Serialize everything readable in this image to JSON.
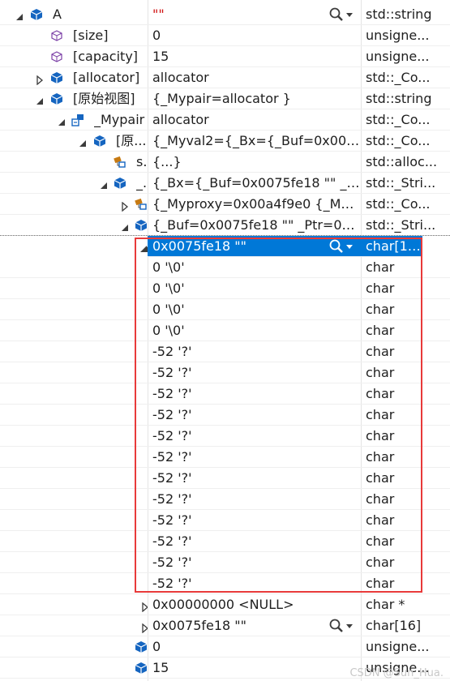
{
  "rows": [
    {
      "name": "A",
      "value": "\"\"",
      "type": "std::string",
      "value_color": "#d01010"
    },
    {
      "name": "[size]",
      "value": "0",
      "type": "unsigne..."
    },
    {
      "name": "[capacity]",
      "value": "15",
      "type": "unsigne..."
    },
    {
      "name": "[allocator]",
      "value": "allocator",
      "type": "std::_Co..."
    },
    {
      "name": "[原始视图]",
      "value": "{_Mypair=allocator }",
      "type": "std::string"
    },
    {
      "name": "_Mypair",
      "value": "allocator",
      "type": "std::_Co..."
    },
    {
      "name": "[原...",
      "value": "{_Myval2={_Bx={_Buf=0x0075fe...",
      "type": "std::_Co..."
    },
    {
      "name": "s...",
      "value": "{...}",
      "type": "std::alloc..."
    },
    {
      "name": "_...",
      "value": "{_Bx={_Buf=0x0075fe18 \"\" _Ptr=...",
      "type": "std::_Stri..."
    },
    {
      "name": "",
      "value": "{_Myproxy=0x00a4f9e0 {_Myc...",
      "type": "std::_Co..."
    },
    {
      "name": "",
      "value": "{_Buf=0x0075fe18 \"\" _Ptr=0x00...",
      "type": "std::_Stri..."
    },
    {
      "name": "",
      "value": "0x0075fe18 \"\"",
      "type": "char[16]"
    },
    {
      "name": "",
      "value": "0 '\\0'",
      "type": "char"
    },
    {
      "name": "",
      "value": "0 '\\0'",
      "type": "char"
    },
    {
      "name": "",
      "value": "0 '\\0'",
      "type": "char"
    },
    {
      "name": "",
      "value": "0 '\\0'",
      "type": "char"
    },
    {
      "name": "",
      "value": "-52 '?'",
      "type": "char"
    },
    {
      "name": "",
      "value": "-52 '?'",
      "type": "char"
    },
    {
      "name": "",
      "value": "-52 '?'",
      "type": "char"
    },
    {
      "name": "",
      "value": "-52 '?'",
      "type": "char"
    },
    {
      "name": "",
      "value": "-52 '?'",
      "type": "char"
    },
    {
      "name": "",
      "value": "-52 '?'",
      "type": "char"
    },
    {
      "name": "",
      "value": "-52 '?'",
      "type": "char"
    },
    {
      "name": "",
      "value": "-52 '?'",
      "type": "char"
    },
    {
      "name": "",
      "value": "-52 '?'",
      "type": "char"
    },
    {
      "name": "",
      "value": "-52 '?'",
      "type": "char"
    },
    {
      "name": "",
      "value": "-52 '?'",
      "type": "char"
    },
    {
      "name": "",
      "value": "-52 '?'",
      "type": "char"
    },
    {
      "name": "",
      "value": "0x00000000 <NULL>",
      "type": "char *"
    },
    {
      "name": "",
      "value": "0x0075fe18 \"\"",
      "type": "char[16]"
    },
    {
      "name": "",
      "value": "0",
      "type": "unsigne..."
    },
    {
      "name": "",
      "value": "15",
      "type": "unsigne..."
    }
  ],
  "watermark": "CSDN @Sun_Hua.",
  "colors": {
    "selection": "#0078d7",
    "highlight_box": "#e83a3a",
    "object_icon": "#1565c0",
    "member_icon": "#7b3fa6",
    "base_icon": "#c77a12"
  }
}
